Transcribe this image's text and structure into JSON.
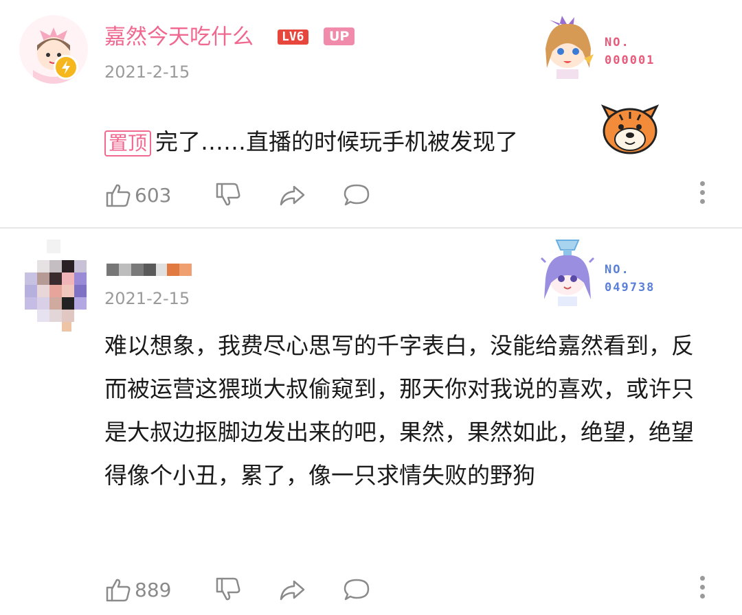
{
  "comments": [
    {
      "username": "嘉然今天吃什么",
      "level_tag": "LV6",
      "up_tag": "UP",
      "date": "2021-2-15",
      "medal": {
        "no_label": "NO.",
        "number": "000001",
        "color": "#e85a7a"
      },
      "pin_label": "置顶",
      "content": "完了……直播的时候玩手机被发现了",
      "sticker": "tiger-face-sticker",
      "likes": "603",
      "avatar": "anime-girl-avatar-icon"
    },
    {
      "username": "",
      "date": "2021-2-15",
      "medal": {
        "no_label": "NO.",
        "number": "049738",
        "color": "#5a7fd8"
      },
      "content": "难以想象，我费尽心思写的千字表白，没能给嘉然看到，反而被运营这猥琐大叔偷窥到，那天你对我说的喜欢，或许只是大叔边抠脚边发出来的吧，果然，果然如此，绝望，绝望得像个小丑，累了，像一只求情失败的野狗",
      "likes": "889",
      "avatar": "pixelated-avatar"
    }
  ],
  "colors": {
    "accent_pink": "#f0678f",
    "text_gray": "#9a9a9a",
    "icon_gray": "#8a8a8a"
  },
  "icons": [
    "like-icon",
    "dislike-icon",
    "share-icon",
    "reply-icon",
    "more-icon"
  ]
}
